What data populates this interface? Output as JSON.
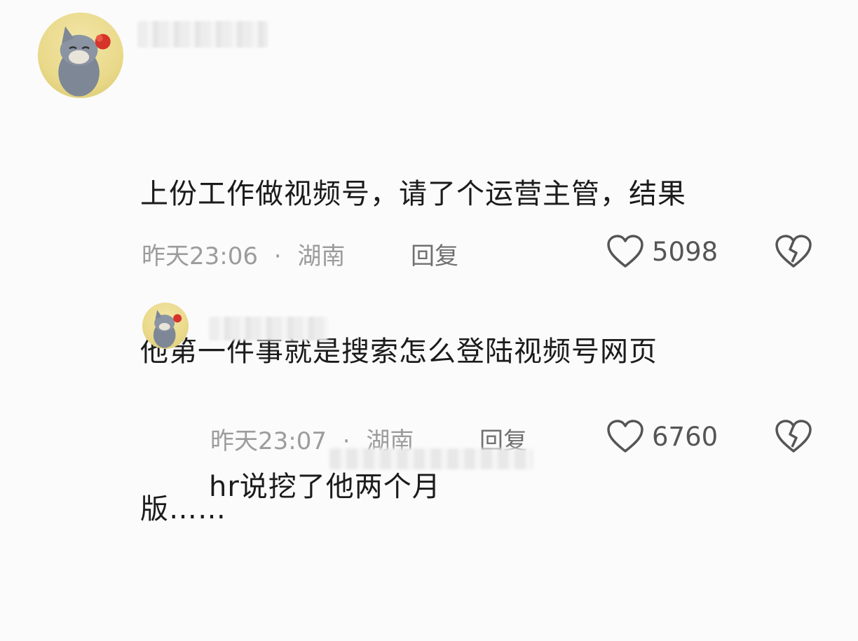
{
  "comments": [
    {
      "text_lines": [
        "上份工作做视频号，请了个运营主管，结果",
        "他第一件事就是搜索怎么登陆视频号网页",
        "版……"
      ],
      "time": "昨天23:06",
      "location": "湖南",
      "reply_label": "回复",
      "likes": "5098"
    },
    {
      "text_lines": [
        "hr说挖了他两个月"
      ],
      "time": "昨天23:07",
      "location": "湖南",
      "reply_label": "回复",
      "likes": "6760"
    }
  ],
  "separator": "·",
  "icons": {
    "like": "heart-outline-icon",
    "dislike": "broken-heart-icon"
  }
}
